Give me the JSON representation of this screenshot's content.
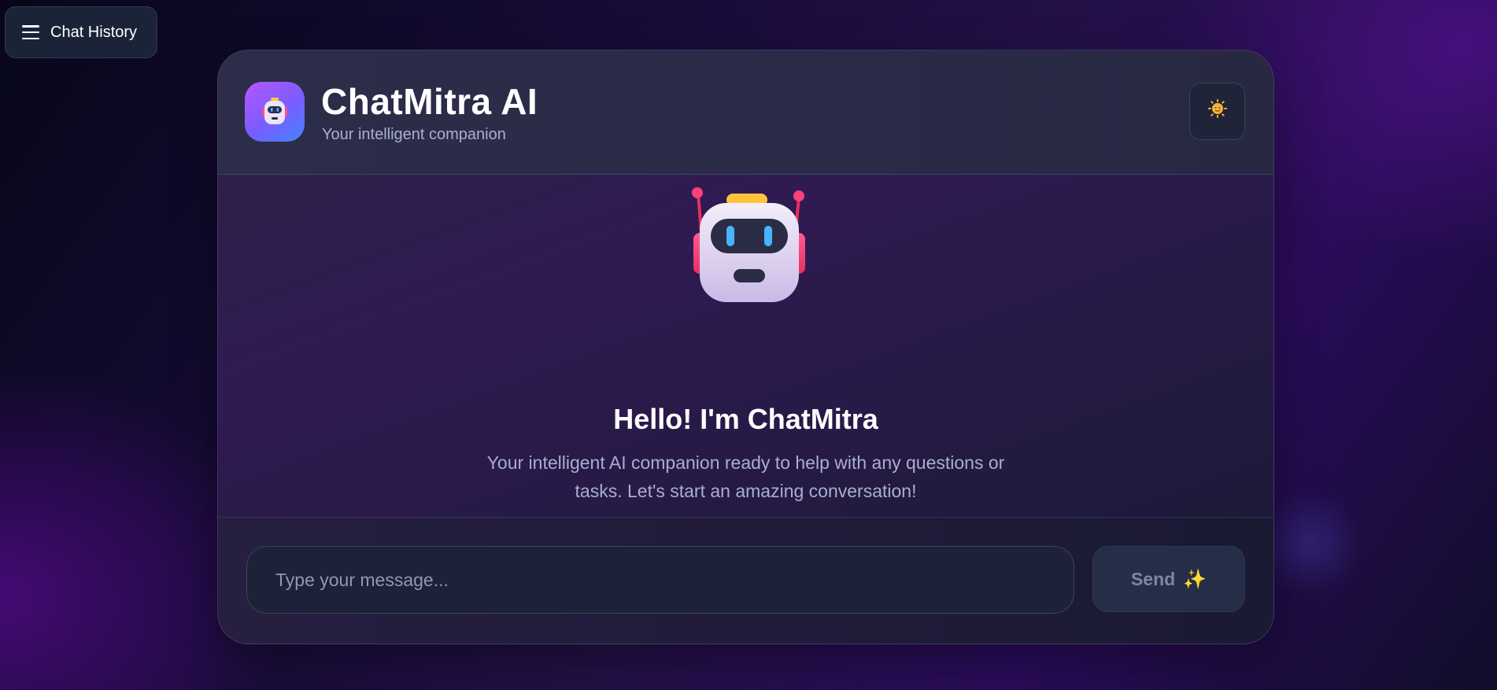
{
  "sidebar_toggle": {
    "label": "Chat History",
    "icon": "hamburger-menu-icon"
  },
  "header": {
    "title": "ChatMitra AI",
    "subtitle": "Your intelligent companion",
    "logo_icon": "robot-logo-icon",
    "theme_toggle_icon": "sun-icon"
  },
  "welcome": {
    "mascot_icon": "robot-mascot-icon",
    "title": "Hello! I'm ChatMitra",
    "text": "Your intelligent AI companion ready to help with any questions or tasks. Let's start an amazing conversation!"
  },
  "composer": {
    "placeholder": "Type your message...",
    "value": "",
    "send_label": "Send",
    "send_icon": "sparkles-icon"
  },
  "colors": {
    "accent_purple": "#b358ff",
    "accent_blue": "#3f86ff",
    "card_bg": "#2c2445",
    "input_bg": "#1e2238"
  }
}
